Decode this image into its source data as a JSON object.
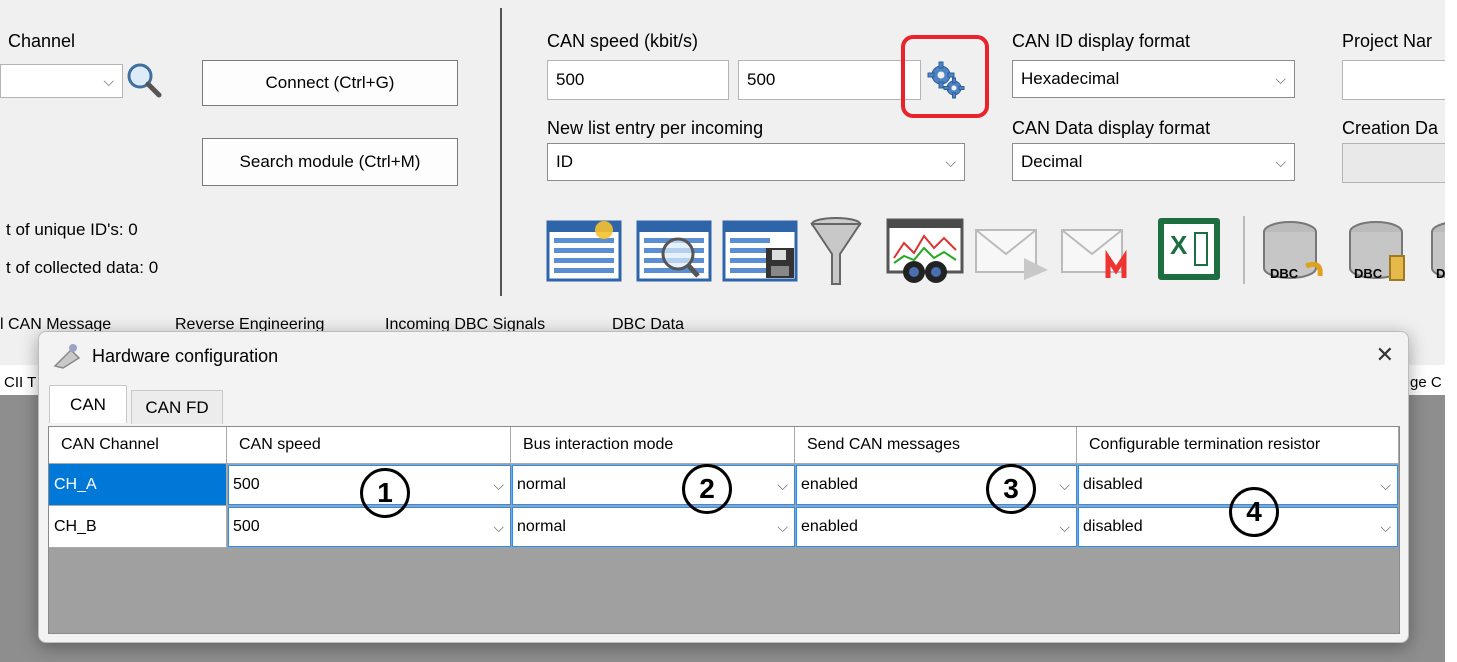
{
  "colors": {
    "selection": "#0078d7",
    "highlight": "#e8232a",
    "excel_green": "#1d6f42"
  },
  "channel": {
    "label": "Channel",
    "select_value": ""
  },
  "buttons": {
    "connect": "Connect (Ctrl+G)",
    "search_module": "Search module (Ctrl+M)"
  },
  "stats": {
    "unique_ids": "t of unique ID's: 0",
    "collected": "t of collected data: 0"
  },
  "can_speed": {
    "label": "CAN speed (kbit/s)",
    "value1": "500",
    "value2": "500"
  },
  "new_list_entry": {
    "label": "New list entry per incoming",
    "value": "ID"
  },
  "can_id_format": {
    "label": "CAN ID display format",
    "value": "Hexadecimal"
  },
  "can_data_format": {
    "label": "CAN Data display format",
    "value": "Decimal"
  },
  "project_name": {
    "label": "Project Nar",
    "value": ""
  },
  "creation_date": {
    "label": "Creation Da",
    "value": ""
  },
  "toolbar_icons": [
    "new-list-icon",
    "analyze-list-icon",
    "save-list-icon",
    "filter-icon",
    "trace-view-icon",
    "send-message-icon",
    "mail-message-icon",
    "excel-icon",
    "dbc-import-icon",
    "dbc-export-icon",
    "dbc-icon"
  ],
  "dbc_labels": [
    "DBC",
    "DBC",
    "D"
  ],
  "excel_letter": "X",
  "main_tabs": [
    "l CAN Message",
    "Reverse Engineering",
    "Incoming DBC Signals",
    "DBC Data"
  ],
  "behind_fragments": {
    "left": "CII T",
    "right": "ge C"
  },
  "dialog": {
    "title": "Hardware configuration",
    "tabs": [
      "CAN",
      "CAN FD"
    ],
    "columns": [
      "CAN Channel",
      "CAN speed",
      "Bus interaction mode",
      "Send CAN messages",
      "Configurable termination resistor"
    ],
    "rows": [
      {
        "channel": "CH_A",
        "speed": "500",
        "mode": "normal",
        "send": "enabled",
        "termination": "disabled"
      },
      {
        "channel": "CH_B",
        "speed": "500",
        "mode": "normal",
        "send": "enabled",
        "termination": "disabled"
      }
    ],
    "callouts": [
      "1",
      "2",
      "3",
      "4"
    ]
  }
}
